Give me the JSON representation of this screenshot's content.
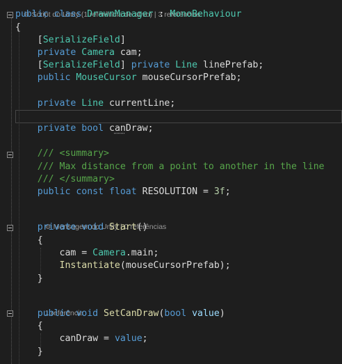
{
  "codelens": {
    "class_lens": "Script do Unity (1 referência de ativo) | 3 referências",
    "start_lens": "Mensagem do Unity | 0 referências",
    "setcandraw_lens": "1 referência"
  },
  "code": {
    "l1_kw1": "public",
    "l1_kw2": " class ",
    "l1_type": "DrawnManager",
    "l1_sep": " : ",
    "l1_base": "MonoBehaviour",
    "l2": "{",
    "l3_b1": "[",
    "l3_attr": "SerializeField",
    "l3_b2": "]",
    "l4_kw": "private ",
    "l4_type": "Camera",
    "l4_rest": " cam;",
    "l5_b1": "[",
    "l5_attr": "SerializeField",
    "l5_b2": "] ",
    "l5_kw": "private ",
    "l5_type": "Line",
    "l5_rest": " linePrefab;",
    "l6_kw": "public ",
    "l6_type": "MouseCursor",
    "l6_rest": " mouseCursorPrefab;",
    "l8_kw": "private ",
    "l8_type": "Line",
    "l8_rest": " currentLine;",
    "l10_kw": "private bool ",
    "l10_a": "c",
    "l10_dots": "an",
    "l10_b": "Draw;",
    "l12_cm": "/// <summary>",
    "l13_cm": "/// Max distance from a point to another in the line",
    "l14_cm": "/// </summary>",
    "l15_kw": "public const float ",
    "l15_name": "RESOLUTION = ",
    "l15_num": "3f",
    "l15_end": ";",
    "l17_kw": "private void ",
    "l17_me": "Start",
    "l17_end": "()",
    "l18": "{",
    "l19_a": "cam = ",
    "l19_type": "Camera",
    "l19_b": ".main;",
    "l20_me": "Instantiate",
    "l20_rest": "(mouseCursorPrefab);",
    "l21": "}",
    "l23_kw": "public void ",
    "l23_me": "SetCanDraw",
    "l23_p1": "(",
    "l23_kw2": "bool ",
    "l23_param": "value",
    "l23_p2": ")",
    "l24": "{",
    "l25_a": "canDraw = ",
    "l25_kw": "value",
    "l25_b": ";",
    "l26": "}"
  },
  "colors": {
    "background": "#1e1e1e",
    "keyword": "#569cd6",
    "type": "#4ec9b0",
    "method": "#dcdcaa",
    "comment": "#57a64a",
    "parameter": "#9cdcfe",
    "number": "#b5cea8",
    "text": "#dcdcdc"
  }
}
